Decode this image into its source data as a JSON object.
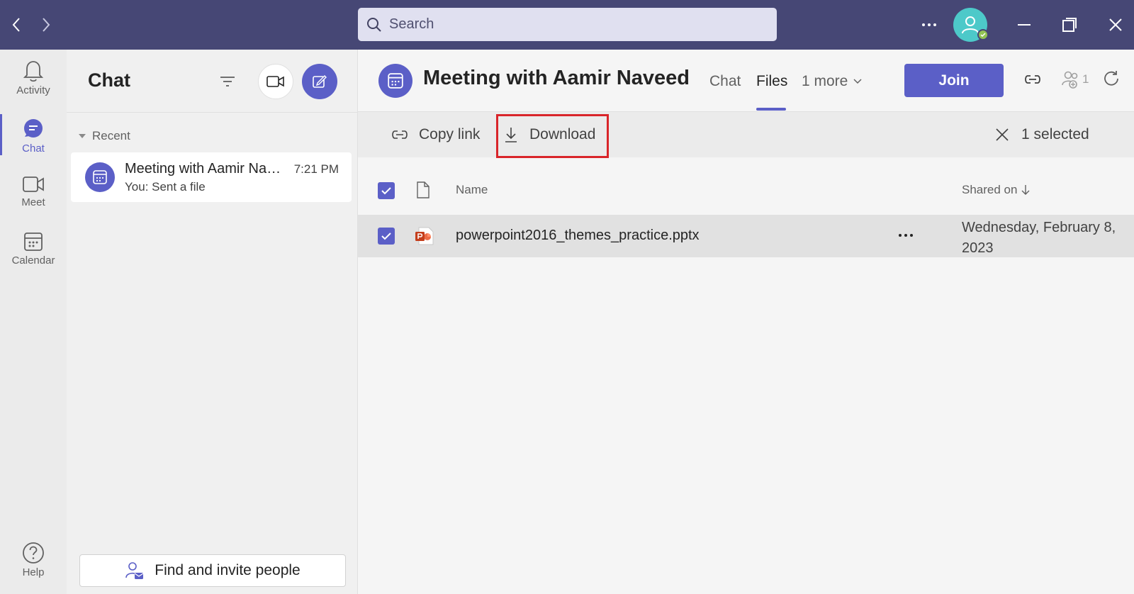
{
  "titlebar": {
    "search_placeholder": "Search",
    "back_icon": "chevron-left-icon",
    "forward_icon": "chevron-right-icon"
  },
  "rail": {
    "items": [
      {
        "label": "Activity",
        "icon": "bell-icon"
      },
      {
        "label": "Chat",
        "icon": "chat-icon"
      },
      {
        "label": "Meet",
        "icon": "video-icon"
      },
      {
        "label": "Calendar",
        "icon": "calendar-icon"
      }
    ],
    "help_label": "Help"
  },
  "chat_list": {
    "title": "Chat",
    "recent_label": "Recent",
    "items": [
      {
        "name": "Meeting with Aamir Naveed",
        "time": "7:21 PM",
        "preview": "You: Sent a file"
      }
    ],
    "find_label": "Find and invite people"
  },
  "main": {
    "title": "Meeting with Aamir Naveed",
    "tabs": [
      "Chat",
      "Files",
      "1 more"
    ],
    "active_tab": "Files",
    "join_label": "Join",
    "participants_count": "1",
    "commands": {
      "copy_link": "Copy link",
      "download": "Download",
      "selected": "1 selected"
    },
    "columns": {
      "name": "Name",
      "shared_on": "Shared on",
      "sort_icon": "arrow-down-icon"
    },
    "files": [
      {
        "name": "powerpoint2016_themes_practice.pptx",
        "shared_on": "Wednesday, February 8, 2023",
        "icon": "powerpoint-file-icon",
        "selected": true
      }
    ]
  },
  "colors": {
    "titlebar": "#464775",
    "accent": "#5b5fc7",
    "highlight": "#d9252a",
    "presence": "#92c353",
    "avatar": "#4dc9c9"
  }
}
